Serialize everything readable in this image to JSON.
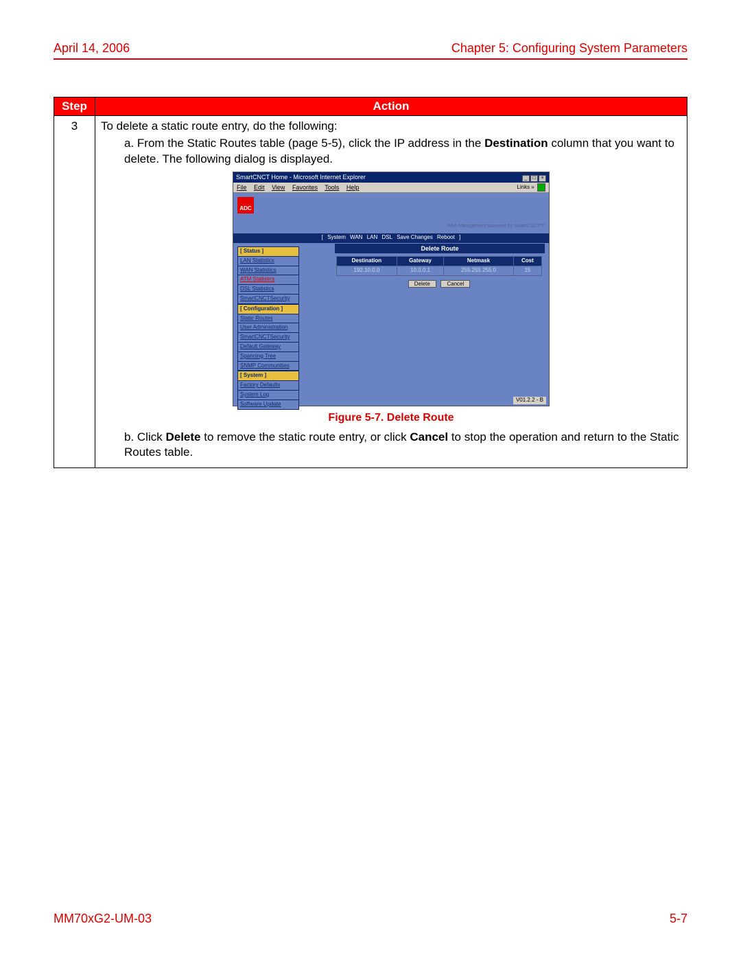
{
  "header": {
    "date": "April 14, 2006",
    "chapter": "Chapter 5: Configuring System Parameters"
  },
  "table": {
    "step_header": "Step",
    "action_header": "Action",
    "step_number": "3",
    "intro": "To delete a static route entry, do the following:",
    "item_a_prefix": "a. ",
    "item_a_text_1": "From the Static Routes table (page 5-5), click the IP address in the ",
    "item_a_bold": "Destination",
    "item_a_text_2": " column that you want to delete. The following dialog is displayed.",
    "item_b_prefix": "b. ",
    "item_b_text_1": "Click ",
    "item_b_bold_1": "Delete",
    "item_b_text_2": " to remove the static route entry, or click ",
    "item_b_bold_2": "Cancel",
    "item_b_text_3": " to stop the operation and return to the Static Routes table."
  },
  "figure_caption": "Figure 5-7. Delete Route",
  "screenshot": {
    "title": "SmartCNCT Home - Microsoft Internet Explorer",
    "menu": [
      "File",
      "Edit",
      "View",
      "Favorites",
      "Tools",
      "Help"
    ],
    "links_label": "Links »",
    "logo": "ADC",
    "top_right": "Web Management powered by SmartCNCT™",
    "nav": [
      "[",
      "System",
      "WAN",
      "LAN",
      "DSL",
      "Save Changes",
      "Reboot",
      "]"
    ],
    "panel_title": "Delete Route",
    "side_sections": {
      "status_label": "[ Status ]",
      "status_items": [
        "LAN Statistics",
        "WAN Statistics",
        "ATM Statistics",
        "DSL Statistics",
        "SmartCNCTSecurity"
      ],
      "config_label": "[ Configuration ]",
      "config_items": [
        "Static Routes",
        "User Administration",
        "SmartCNCTSecurity",
        "Default Gateway",
        "Spanning Tree",
        "SNMP Communities"
      ],
      "system_label": "[ System ]",
      "system_items": [
        "Factory Defaults",
        "System Log",
        "Software Update"
      ]
    },
    "route_table": {
      "headers": [
        "Destination",
        "Gateway",
        "Netmask",
        "Cost"
      ],
      "row": [
        "192.10.0.0",
        "10.0.0.1",
        "255.255.255.0",
        "15"
      ]
    },
    "buttons": {
      "delete": "Delete",
      "cancel": "Cancel"
    },
    "version": "V01.2.2 - B"
  },
  "footer": {
    "doc": "MM70xG2-UM-03",
    "page": "5-7"
  }
}
